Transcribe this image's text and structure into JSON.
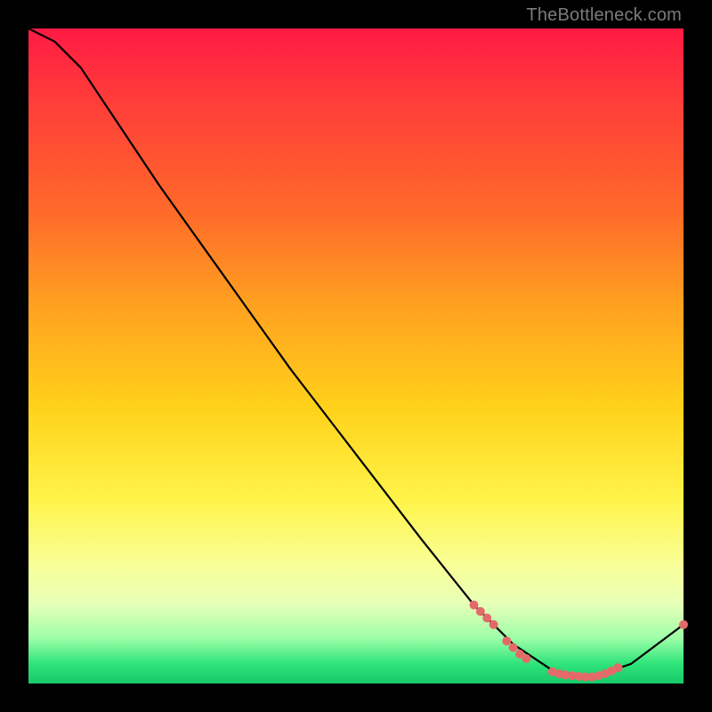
{
  "watermark": "TheBottleneck.com",
  "annotation_text": "",
  "chart_data": {
    "type": "line",
    "title": "",
    "xlabel": "",
    "ylabel": "",
    "xlim": [
      0,
      100
    ],
    "ylim": [
      0,
      100
    ],
    "grid": false,
    "legend": false,
    "curve": [
      {
        "x": 0,
        "y": 100
      },
      {
        "x": 4,
        "y": 98
      },
      {
        "x": 8,
        "y": 94
      },
      {
        "x": 12,
        "y": 88
      },
      {
        "x": 20,
        "y": 76
      },
      {
        "x": 30,
        "y": 62
      },
      {
        "x": 40,
        "y": 48
      },
      {
        "x": 50,
        "y": 35
      },
      {
        "x": 60,
        "y": 22
      },
      {
        "x": 68,
        "y": 12
      },
      {
        "x": 74,
        "y": 6
      },
      {
        "x": 80,
        "y": 2
      },
      {
        "x": 86,
        "y": 1
      },
      {
        "x": 92,
        "y": 3
      },
      {
        "x": 100,
        "y": 9
      }
    ],
    "marker_clusters": [
      {
        "x": 68,
        "y": 12
      },
      {
        "x": 69,
        "y": 11
      },
      {
        "x": 70,
        "y": 10
      },
      {
        "x": 71,
        "y": 9
      },
      {
        "x": 73,
        "y": 6.5
      },
      {
        "x": 74,
        "y": 5.5
      },
      {
        "x": 75,
        "y": 4.5
      },
      {
        "x": 76,
        "y": 3.8
      },
      {
        "x": 80,
        "y": 1.8
      },
      {
        "x": 81,
        "y": 1.5
      },
      {
        "x": 82,
        "y": 1.3
      },
      {
        "x": 83,
        "y": 1.2
      },
      {
        "x": 84,
        "y": 1.1
      },
      {
        "x": 85,
        "y": 1.0
      },
      {
        "x": 86,
        "y": 1.0
      },
      {
        "x": 87,
        "y": 1.2
      },
      {
        "x": 88,
        "y": 1.5
      },
      {
        "x": 89,
        "y": 1.9
      },
      {
        "x": 90,
        "y": 2.4
      },
      {
        "x": 100,
        "y": 9
      }
    ],
    "colors": {
      "curve": "#000000",
      "markers": "#e46a6a",
      "gradient_top": "#ff1a44",
      "gradient_mid": "#ffd21a",
      "gradient_bottom": "#18c96a",
      "background": "#000000"
    }
  }
}
